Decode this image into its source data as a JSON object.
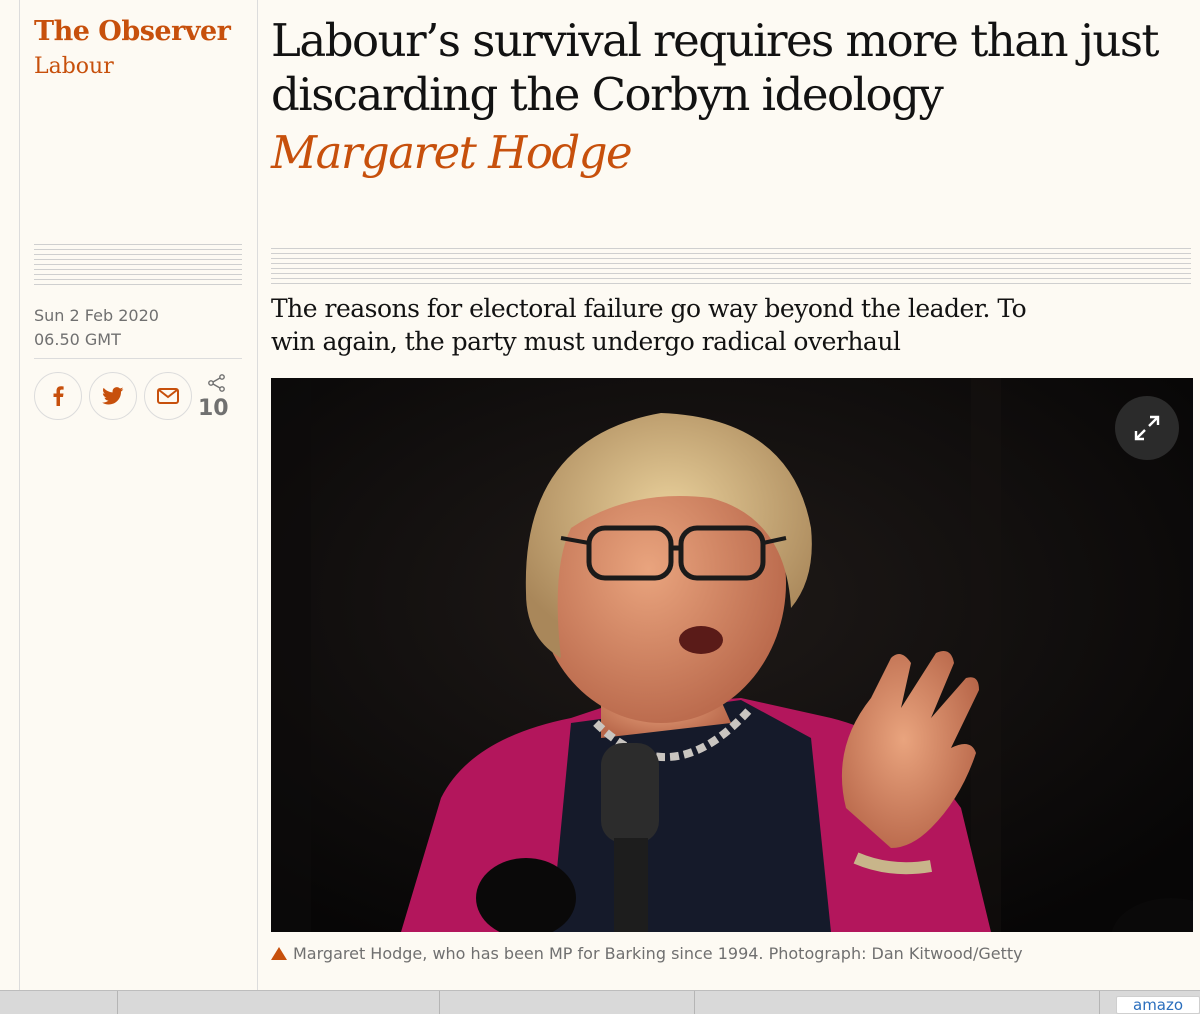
{
  "brand": {
    "name": "The Observer",
    "section": "Labour",
    "accent_color": "#c7500c"
  },
  "article": {
    "headline": "Labour’s survival requires more than just discarding the Corbyn ideology",
    "byline": "Margaret Hodge",
    "standfirst": "The reasons for electoral failure go way beyond the leader. To win again, the party must undergo radical overhaul",
    "date": "Sun 2 Feb 2020",
    "time": "06.50 GMT"
  },
  "share": {
    "icons": [
      "facebook-icon",
      "twitter-icon",
      "email-icon",
      "share-icon"
    ],
    "count": "10"
  },
  "image": {
    "caption": "Margaret Hodge, who has been MP for Barking since 1994. Photograph: Dan Kitwood/Getty",
    "expand_icon": "expand-icon"
  },
  "browser": {
    "bookmark_label": "amazo"
  }
}
